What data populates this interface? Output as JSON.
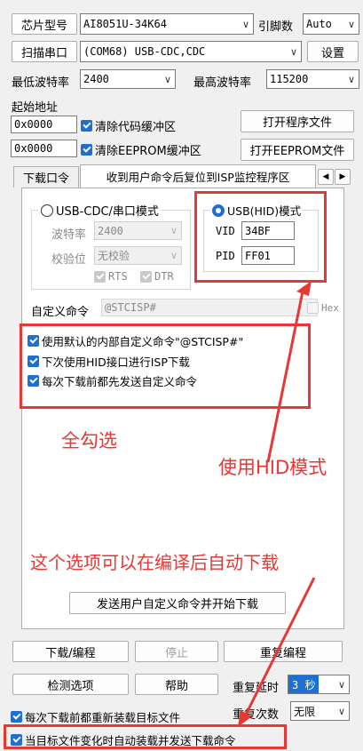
{
  "chip": {
    "label": "芯片型号",
    "value": "AI8051U-34K64",
    "pins_label": "引脚数",
    "pins_value": "Auto"
  },
  "port": {
    "scan_label": "扫描串口",
    "value": "(COM68) USB-CDC,CDC",
    "settings_label": "设置"
  },
  "baud": {
    "min_label": "最低波特率",
    "min_value": "2400",
    "max_label": "最高波特率",
    "max_value": "115200"
  },
  "start_addr": {
    "label": "起始地址",
    "code_addr": "0x0000",
    "code_clear_label": "清除代码缓冲区",
    "open_program_label": "打开程序文件",
    "eeprom_addr": "0x0000",
    "eeprom_clear_label": "清除EEPROM缓冲区",
    "open_eeprom_label": "打开EEPROM文件"
  },
  "tabs": {
    "tab1": "下载口令",
    "tab2": "收到用户命令后复位到ISP监控程序区"
  },
  "cdc_mode": {
    "label": "USB-CDC/串口模式",
    "baud_label": "波特率",
    "baud_value": "2400",
    "parity_label": "校验位",
    "parity_value": "无校验",
    "rts_label": "RTS",
    "dtr_label": "DTR"
  },
  "hid_mode": {
    "label": "USB(HID)模式",
    "vid_label": "VID",
    "vid_value": "34BF",
    "pid_label": "PID",
    "pid_value": "FF01"
  },
  "custom_cmd": {
    "label": "自定义命令",
    "value": "@STCISP#",
    "hex_label": "Hex",
    "opt1": "使用默认的内部自定义命令\"@STCISP#\"",
    "opt2": "下次使用HID接口进行ISP下载",
    "opt3": "每次下载前都先发送自定义命令"
  },
  "annotations": {
    "check_all": "全勾选",
    "use_hid": "使用HID模式",
    "auto_download": "这个选项可以在编译后自动下载"
  },
  "send_button": "发送用户自定义命令并开始下载",
  "actions": {
    "download": "下载/编程",
    "stop": "停止",
    "repeat": "重复编程",
    "check": "检测选项",
    "help": "帮助",
    "delay_label": "重复延时",
    "delay_value": "3 秒",
    "count_label": "重复次数",
    "count_value": "无限",
    "reload_label": "每次下载前都重新装载目标文件",
    "auto_label": "当目标文件变化时自动装载并发送下载命令"
  },
  "colors": {
    "accent": "#1f6fd1",
    "annotation": "#e53935"
  }
}
